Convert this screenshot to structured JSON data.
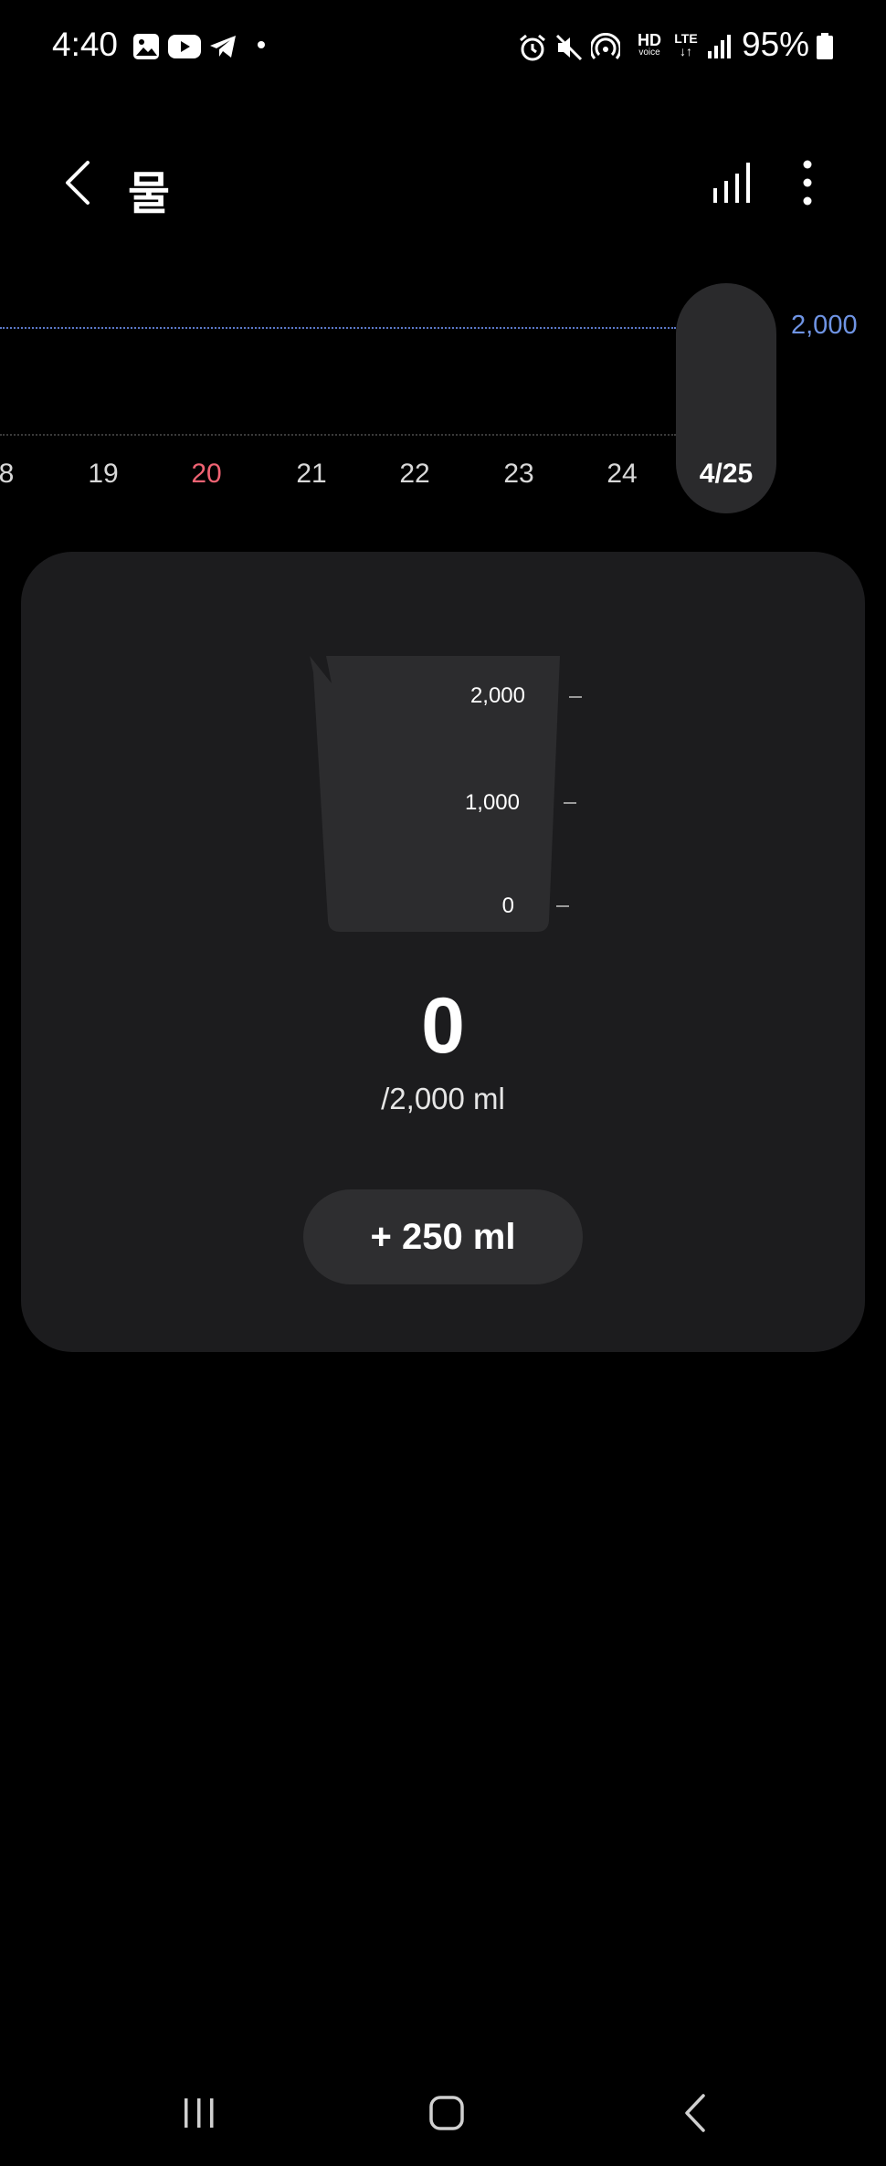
{
  "status_bar": {
    "time": "4:40",
    "battery_percent": "95%",
    "left_icons": [
      "gallery-icon",
      "youtube-icon",
      "telegram-icon",
      "dot-icon"
    ],
    "right_icons": [
      "alarm-icon",
      "mute-icon",
      "hotspot-icon",
      "hd-voice-icon",
      "lte-icon",
      "signal-icon",
      "battery-icon"
    ],
    "hd_label": "HD",
    "voice_label": "voice",
    "lte_label": "LTE"
  },
  "header": {
    "title": "물"
  },
  "week_chart": {
    "goal_value": "2,000",
    "days": [
      {
        "label": "8",
        "type": "normal"
      },
      {
        "label": "19",
        "type": "normal"
      },
      {
        "label": "20",
        "type": "sunday"
      },
      {
        "label": "21",
        "type": "normal"
      },
      {
        "label": "22",
        "type": "normal"
      },
      {
        "label": "23",
        "type": "normal"
      },
      {
        "label": "24",
        "type": "normal"
      },
      {
        "label": "4/25",
        "type": "selected"
      }
    ]
  },
  "card": {
    "scale_labels": [
      "2,000",
      "1,000",
      "0"
    ],
    "intake_value": "0",
    "goal_text": "/2,000 ml",
    "add_button_label": "+ 250 ml"
  },
  "colors": {
    "background": "#000000",
    "card": "#1c1c1e",
    "accent_blue": "#6f94e4",
    "sunday_red": "#f06373"
  }
}
